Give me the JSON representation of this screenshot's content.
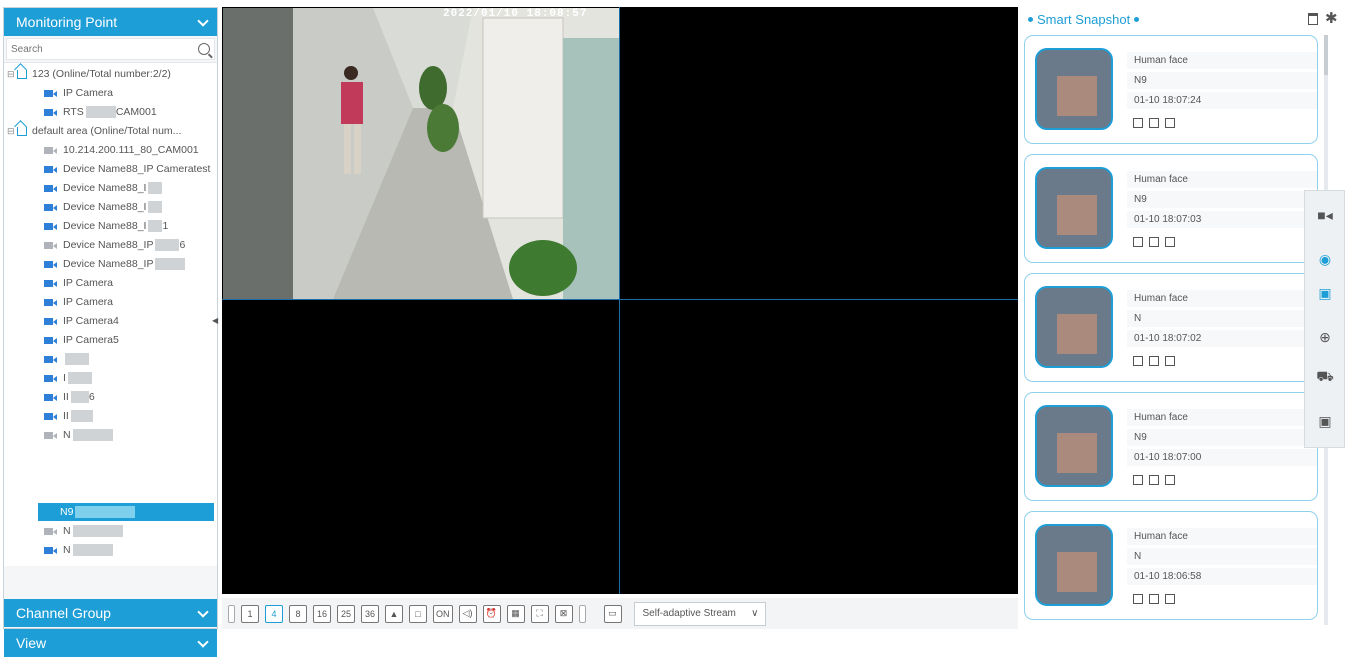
{
  "left_panel": {
    "monitoring_title": "Monitoring Point",
    "search_placeholder": "Search",
    "channel_group": "Channel Group",
    "view": "View",
    "tree": [
      {
        "label": "123 (Online/Total number:2/2)",
        "type": "area"
      },
      {
        "label": "IP Camera",
        "type": "camera"
      },
      {
        "label": "RTS",
        "label2": "CAM001",
        "type": "camera"
      },
      {
        "label": "default area (Online/Total num...",
        "type": "area"
      },
      {
        "label": "10.214.200.111_80_CAM001",
        "type": "camera-off"
      },
      {
        "label": "Device Name88_IP Cameratest",
        "type": "camera"
      },
      {
        "label": "Device Name88_I",
        "type": "camera"
      },
      {
        "label": "Device Name88_I",
        "type": "camera"
      },
      {
        "label": "Device Name88_I",
        "label2": "1",
        "type": "camera"
      },
      {
        "label": "Device Name88_IP",
        "label2": "6",
        "type": "camera-off"
      },
      {
        "label": "Device Name88_IP",
        "type": "camera"
      },
      {
        "label": "IP Camera",
        "type": "camera"
      },
      {
        "label": "IP Camera",
        "type": "camera"
      },
      {
        "label": "IP Camera4",
        "type": "camera"
      },
      {
        "label": "IP Camera5",
        "type": "camera"
      },
      {
        "label": "",
        "type": "camera"
      },
      {
        "label": "I",
        "type": "camera"
      },
      {
        "label": "II",
        "label2": "6",
        "type": "camera"
      },
      {
        "label": "II",
        "type": "camera"
      },
      {
        "label": "N",
        "type": "camera-off"
      },
      {
        "label": "N9",
        "type": "selected"
      },
      {
        "label": "N",
        "type": "camera-off"
      },
      {
        "label": "N",
        "type": "camera"
      }
    ]
  },
  "video": {
    "timestamp": "2022/01/10 18:08:57"
  },
  "toolbar": {
    "buttons": [
      "1",
      "4",
      "8",
      "16",
      "25",
      "36",
      "▲",
      "□",
      "ON",
      "◁)",
      "⏰",
      "▦",
      "⛶",
      "⊠"
    ],
    "active": "4",
    "stream_label": "Self-adaptive Stream"
  },
  "snapshot": {
    "title": "Smart Snapshot",
    "cards": [
      {
        "type": "Human face",
        "name": "N9",
        "time": "01-10 18:07:24"
      },
      {
        "type": "Human face",
        "name": "N9",
        "time": "01-10 18:07:03"
      },
      {
        "type": "Human face",
        "name": "N",
        "time": "01-10 18:07:02"
      },
      {
        "type": "Human face",
        "name": "N9",
        "time": "01-10 18:07:00"
      },
      {
        "type": "Human face",
        "name": "N",
        "time": "01-10 18:06:58"
      }
    ]
  },
  "colors": {
    "accent": "#1e9ed6",
    "video_bg": "#000000",
    "grid_line": "#1b6ea8"
  }
}
